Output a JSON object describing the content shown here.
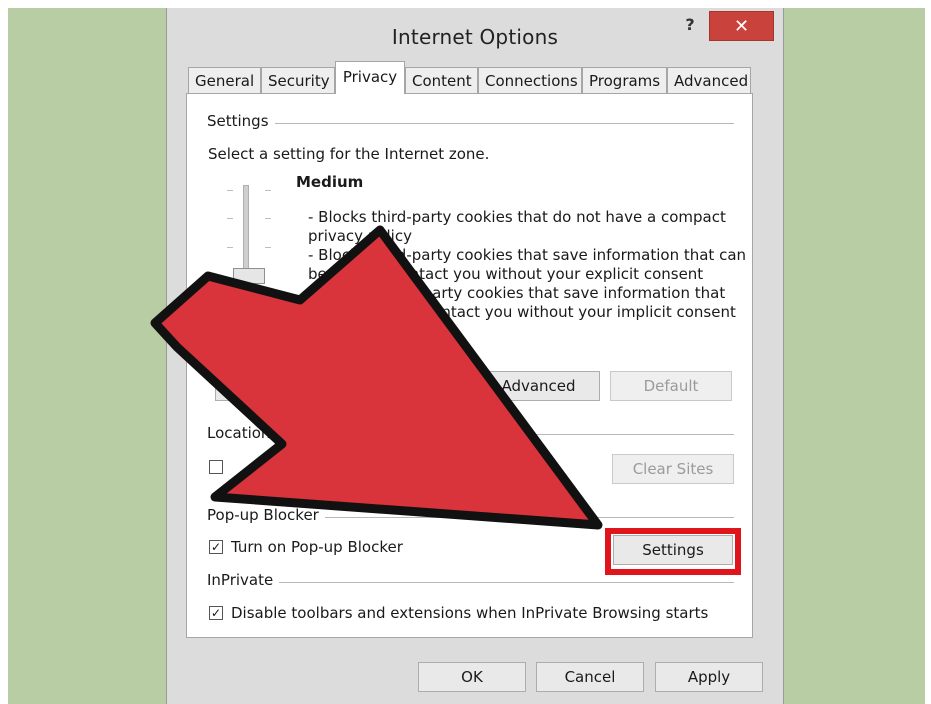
{
  "window": {
    "title": "Internet Options",
    "help": "?",
    "close": "✕"
  },
  "tabs": [
    "General",
    "Security",
    "Privacy",
    "Content",
    "Connections",
    "Programs",
    "Advanced"
  ],
  "active_tab": "Privacy",
  "settings": {
    "header": "Settings",
    "instruction": "Select a setting for the Internet zone.",
    "level": "Medium",
    "desc_lines": [
      "- Blocks third-party cookies that do not have a compact",
      "privacy policy",
      "- Blocks third-party cookies that save information that can",
      "be used to contact you without your explicit consent",
      "- Restricts first-party cookies that save information that",
      "can be used to contact you without your implicit consent"
    ],
    "advanced_button": "Advanced",
    "default_button": "Default"
  },
  "location": {
    "header": "Location",
    "clear_sites_button": "Clear Sites"
  },
  "popup": {
    "header": "Pop-up Blocker",
    "checkbox_label": "Turn on Pop-up Blocker",
    "checked": true,
    "settings_button": "Settings"
  },
  "inprivate": {
    "header": "InPrivate",
    "checkbox_label": "Disable toolbars and extensions when InPrivate Browsing starts",
    "checked": true
  },
  "footer": {
    "ok": "OK",
    "cancel": "Cancel",
    "apply": "Apply"
  },
  "colors": {
    "background": "#b9cda4",
    "close_button": "#c9423b",
    "arrow_fill": "#d9333b",
    "highlight": "#e0141b"
  }
}
